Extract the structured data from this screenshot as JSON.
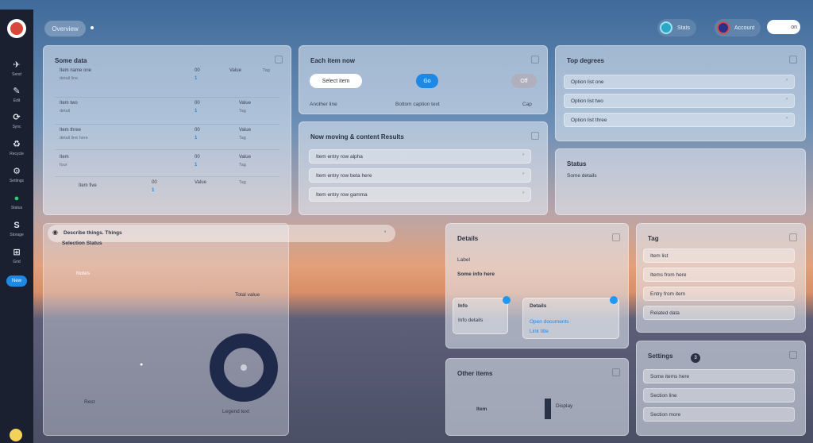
{
  "colors": {
    "accent": "#1e88e5",
    "sidebar_bg": "#1a2030",
    "ring": "#1f2a4a"
  },
  "sidebar": {
    "items": [
      {
        "icon": "send-icon",
        "glyph": "✈",
        "label": "Send"
      },
      {
        "icon": "edit-icon",
        "glyph": "✎",
        "label": "Edit"
      },
      {
        "icon": "sync-icon",
        "glyph": "⟳",
        "label": "Sync"
      },
      {
        "icon": "recycle-icon",
        "glyph": "♻",
        "label": "Recycle"
      },
      {
        "icon": "gear-icon",
        "glyph": "⚙",
        "label": "Settings"
      },
      {
        "icon": "status-icon",
        "glyph": "●",
        "label": "Status"
      },
      {
        "icon": "storage-icon",
        "glyph": "S",
        "label": "Storage"
      },
      {
        "icon": "grid-icon",
        "glyph": "⊞",
        "label": "Grid"
      }
    ],
    "pill_label": "New"
  },
  "topbar": {
    "left_pill": "Overview",
    "chip_1": "Stats",
    "chip_2": "Account",
    "toggle_label": "on"
  },
  "card_table": {
    "title": "Some data",
    "rows": [
      {
        "c1": "Item name one",
        "c1sub": "detail line",
        "c2": "00",
        "c2b": "1",
        "c3": "Value",
        "c4": "Tag"
      },
      {
        "c1": "Item two",
        "c1sub": "detail",
        "c2": "00",
        "c2b": "1",
        "c3": "Value",
        "c4": "Tag"
      },
      {
        "c1": "Item three",
        "c1sub": "detail line here",
        "c2": "00",
        "c2b": "1",
        "c3": "Value",
        "c4": "Tag"
      },
      {
        "c1": "Item",
        "c1sub": "four",
        "c2": "00",
        "c2b": "1",
        "c3": "Value",
        "c4": "Tag"
      },
      {
        "c1": "Item five",
        "c1sub": "",
        "c2": "00",
        "c2b": "1",
        "c3": "Value",
        "c4": "Tag"
      }
    ]
  },
  "card_actions": {
    "title": "Each item now",
    "btn_primary": "Select item",
    "btn_blue": "Go",
    "btn_grey": "Off",
    "captions": [
      "Another line",
      "Bottom caption text",
      "Cap"
    ]
  },
  "card_list_mid": {
    "title": "Now moving & content Results",
    "rows": [
      "Item entry row alpha",
      "Item entry row beta here",
      "Item entry row gamma"
    ]
  },
  "card_list_right": {
    "title": "Top degrees",
    "rows": [
      "Option list one",
      "Option list two",
      "Option list three"
    ]
  },
  "card_small_right": {
    "title": "Status",
    "text": "Some details"
  },
  "big_panel": {
    "search_text": "Describe things. Things",
    "subtitle": "Selection Status",
    "left_note": "Notes",
    "ring_label": "Total value",
    "legend_label": "Legend text",
    "bottom_label": "Rest"
  },
  "card_details": {
    "title": "Details",
    "line1": "Label",
    "line2": "Some info here",
    "left_box": {
      "title": "Info",
      "text": "Info details"
    },
    "right_box": {
      "title": "Details",
      "text": "Open documents",
      "text2": "Link title"
    }
  },
  "card_bottom_mid": {
    "title": "Other items",
    "label_left": "Item",
    "label_right": "Display"
  },
  "card_side_list": {
    "title": "Tag",
    "rows": [
      "Item list",
      "Items from here",
      "Entry from item",
      "Related data"
    ]
  },
  "card_side_list2": {
    "title": "Settings",
    "badge": "3",
    "rows": [
      "Some items here",
      "Section line",
      "Section more"
    ]
  }
}
